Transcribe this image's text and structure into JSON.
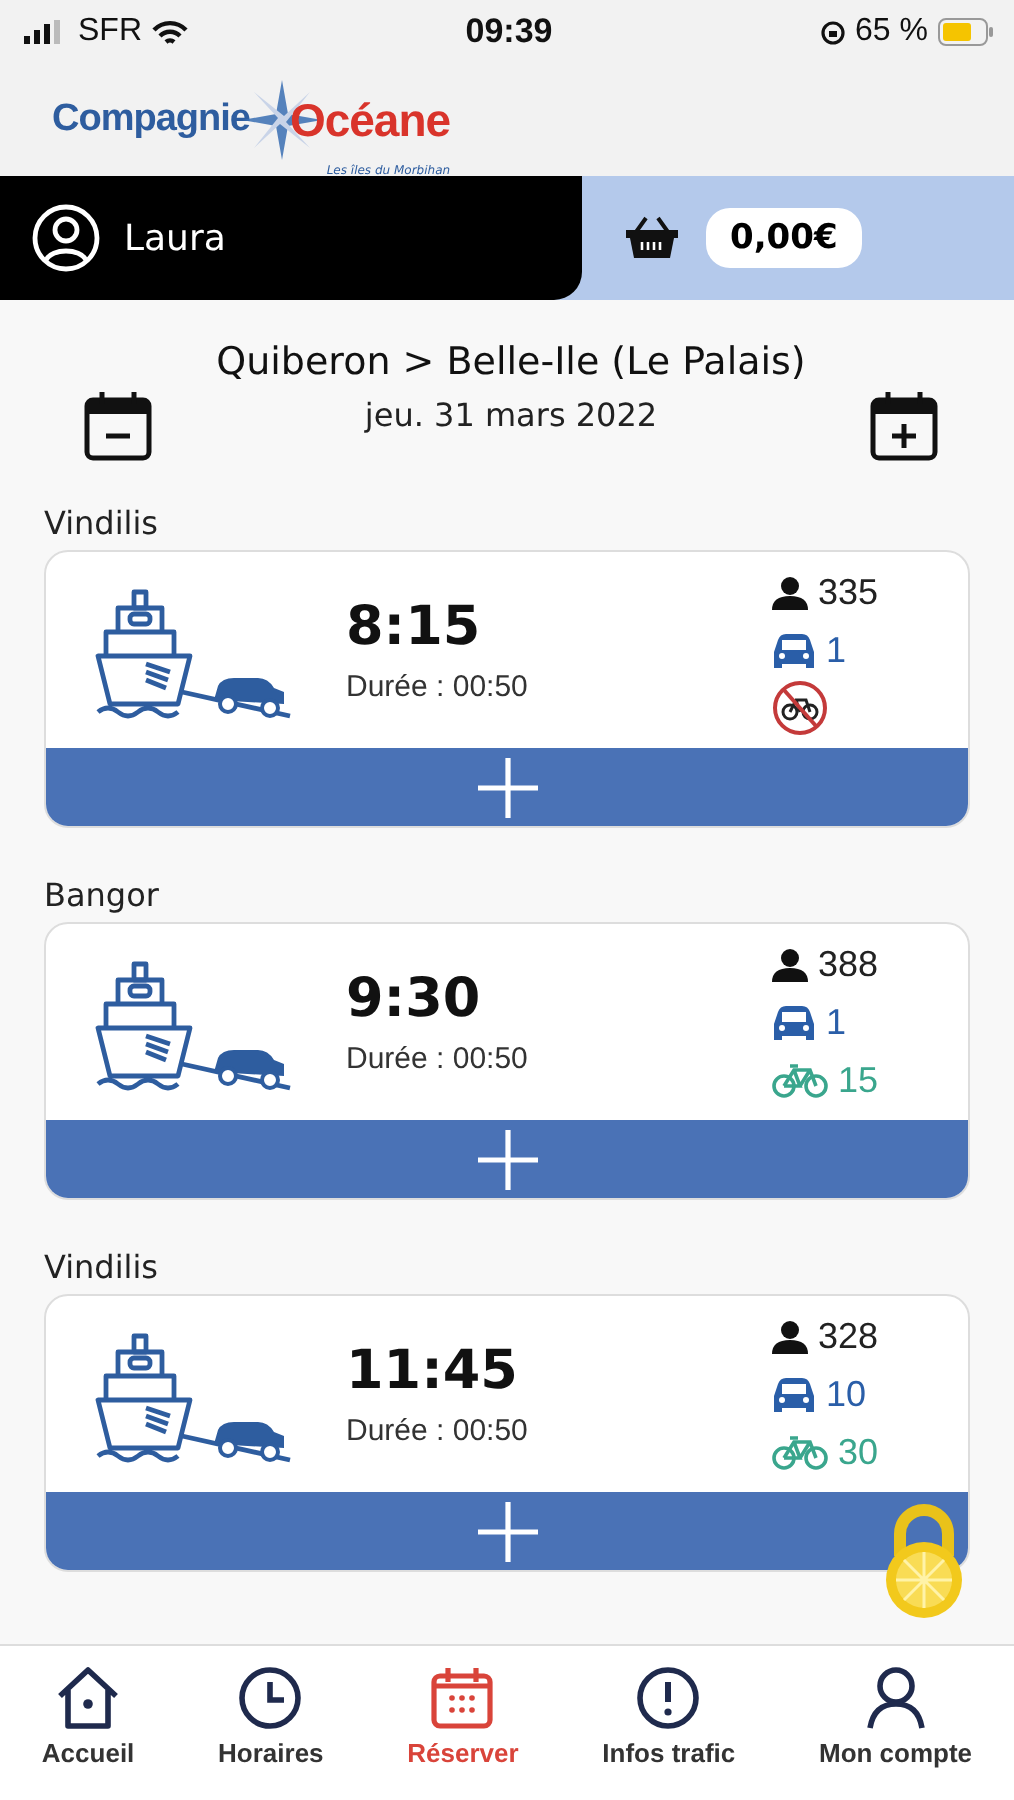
{
  "status_bar": {
    "carrier": "SFR",
    "time": "09:39",
    "battery": "65 %"
  },
  "logo": {
    "name_part1": "Compagnie",
    "name_part2": "Océane",
    "tagline": "Les îles du Morbihan"
  },
  "user": {
    "name": "Laura"
  },
  "basket": {
    "total": "0,00€"
  },
  "route": {
    "title": "Quiberon > Belle-Ile (Le Palais)",
    "date": "jeu. 31 mars 2022"
  },
  "sailings": [
    {
      "vessel": "Vindilis",
      "time": "8:15",
      "duration": "Durée : 00:50",
      "passengers": "335",
      "cars": "1",
      "bikes_allowed": false
    },
    {
      "vessel": "Bangor",
      "time": "9:30",
      "duration": "Durée : 00:50",
      "passengers": "388",
      "cars": "1",
      "bikes_allowed": true,
      "bikes": "15"
    },
    {
      "vessel": "Vindilis",
      "time": "11:45",
      "duration": "Durée : 00:50",
      "passengers": "328",
      "cars": "10",
      "bikes_allowed": true,
      "bikes": "30"
    }
  ],
  "nav": [
    {
      "kind": "home",
      "label": "Accueil",
      "selected": false
    },
    {
      "kind": "clock",
      "label": "Horaires",
      "selected": false
    },
    {
      "kind": "calendar",
      "label": "Réserver",
      "selected": true
    },
    {
      "kind": "alert",
      "label": "Infos trafic",
      "selected": false
    },
    {
      "kind": "account",
      "label": "Mon compte",
      "selected": false
    }
  ]
}
